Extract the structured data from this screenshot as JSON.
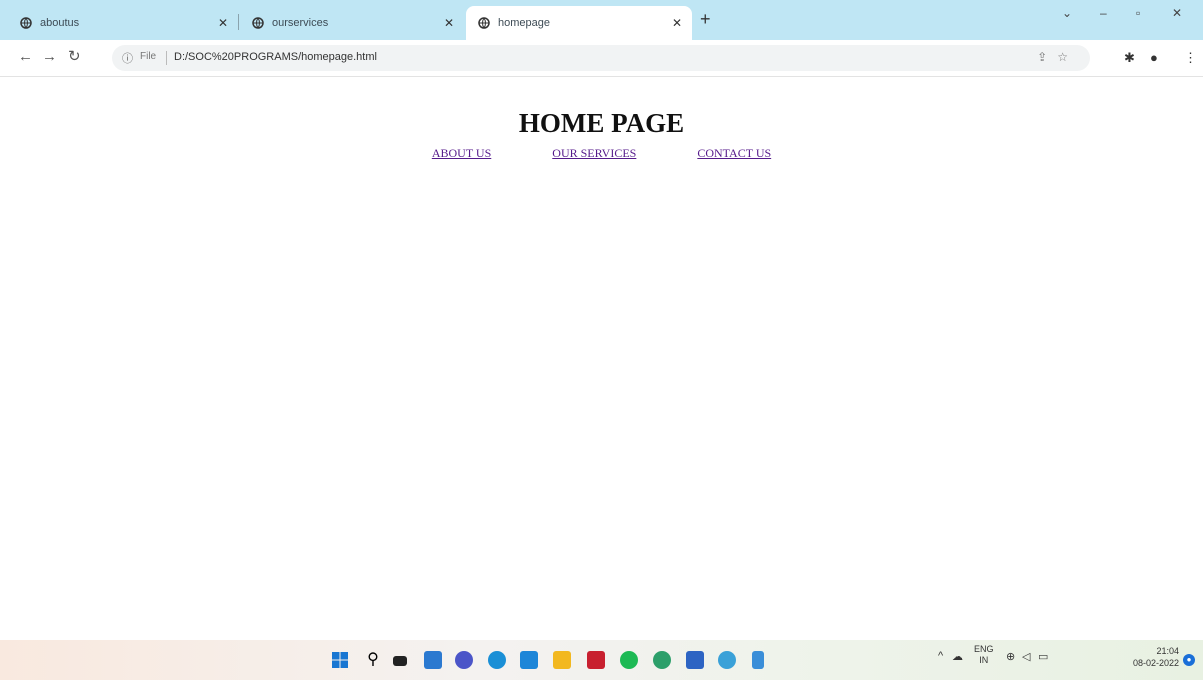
{
  "browser": {
    "tabs": [
      {
        "label": "aboutus"
      },
      {
        "label": "ourservices"
      },
      {
        "label": "homepage"
      }
    ],
    "address": {
      "scheme_label": "File",
      "url": "D:/SOC%20PROGRAMS/homepage.html"
    }
  },
  "page": {
    "title": "HOME PAGE",
    "links": [
      {
        "label": "ABOUT US"
      },
      {
        "label": "OUR SERVICES"
      },
      {
        "label": "CONTACT US"
      }
    ]
  },
  "taskbar": {
    "lang_top": "ENG",
    "lang_bottom": "IN",
    "time": "21:04",
    "date": "08-02-2022"
  },
  "colors": {
    "tab_strip": "#bfe6f4",
    "visited_link": "#551a8b"
  }
}
